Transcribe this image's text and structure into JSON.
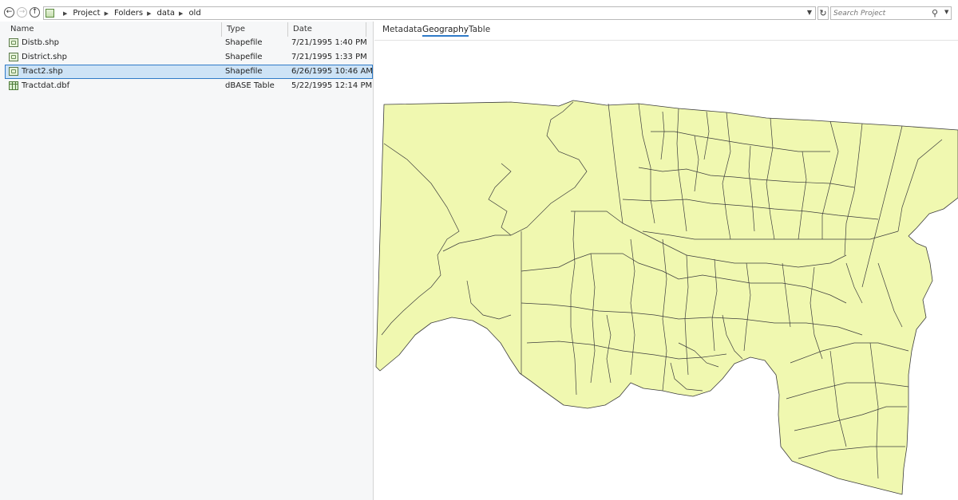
{
  "toolbar": {
    "breadcrumb": [
      "Project",
      "Folders",
      "data",
      "old"
    ],
    "search_placeholder": "Search Project"
  },
  "file_list": {
    "columns": [
      "Name",
      "Type",
      "Date"
    ],
    "rows": [
      {
        "name": "Distb.shp",
        "type": "Shapefile",
        "date": "7/21/1995 1:40 PM",
        "icon": "shapefile-icon"
      },
      {
        "name": "District.shp",
        "type": "Shapefile",
        "date": "7/21/1995 1:33 PM",
        "icon": "shapefile-icon"
      },
      {
        "name": "Tract2.shp",
        "type": "Shapefile",
        "date": "6/26/1995 10:46 AM",
        "icon": "shapefile-icon",
        "selected": true
      },
      {
        "name": "Tractdat.dbf",
        "type": "dBASE Table",
        "date": "5/22/1995 12:14 PM",
        "icon": "dbase-table-icon"
      }
    ]
  },
  "preview": {
    "tabs": [
      "Metadata",
      "Geography",
      "Table"
    ],
    "active_tab": "Geography"
  },
  "colors": {
    "map_fill": "#f0f8b0",
    "map_stroke": "#3d3d3d",
    "selection": "#cde3f6",
    "accent": "#2f7bc8"
  }
}
